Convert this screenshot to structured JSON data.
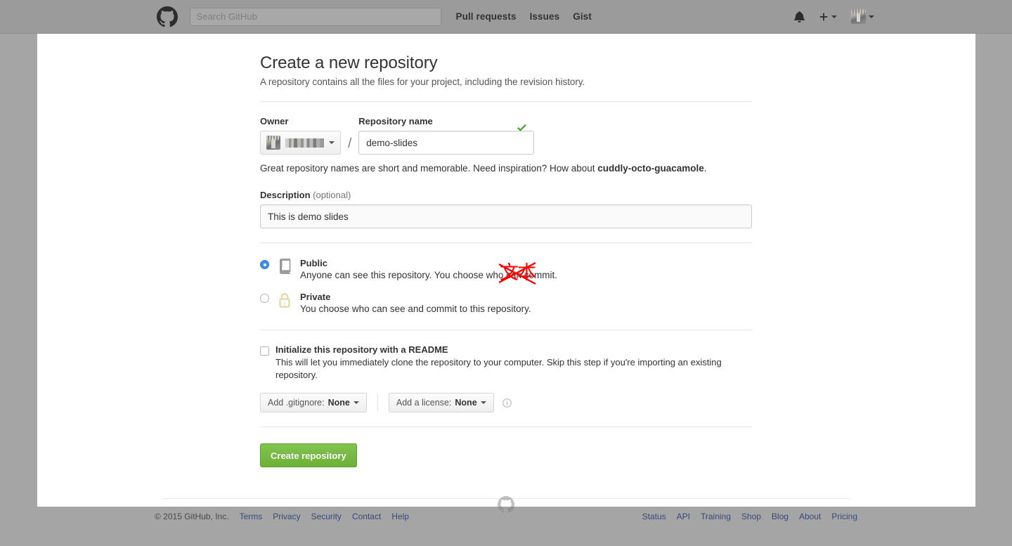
{
  "header": {
    "logo_icon": "github-mark-icon",
    "search": {
      "placeholder": "Search GitHub",
      "value": ""
    },
    "nav": [
      {
        "label": "Pull requests"
      },
      {
        "label": "Issues"
      },
      {
        "label": "Gist"
      }
    ],
    "notifications_icon": "bell-icon",
    "create_new_icon": "plus-icon",
    "create_new_caret": "chevron-down-icon",
    "avatar_caret": "chevron-down-icon"
  },
  "main": {
    "title": "Create a new repository",
    "subtitle": "A repository contains all the files for your project, including the revision history.",
    "owner": {
      "label": "Owner",
      "name_redacted": true,
      "caret_icon": "chevron-down-icon"
    },
    "separator": "/",
    "repository_name": {
      "label": "Repository name",
      "value": "demo-slides",
      "placeholder": "",
      "valid_icon": "check-icon"
    },
    "hint": {
      "prefix": "Great repository names are short and memorable. Need inspiration? How about ",
      "suggestion": "cuddly-octo-guacamole",
      "suffix": "."
    },
    "description": {
      "label": "Description",
      "optional_tag": "(optional)",
      "value": "This is demo slides",
      "placeholder": ""
    },
    "visibility": [
      {
        "id": "public",
        "title": "Public",
        "description": "Anyone can see this repository. You choose who can commit.",
        "icon": "repo-book-icon",
        "selected": true
      },
      {
        "id": "private",
        "title": "Private",
        "description": "You choose who can see and commit to this repository.",
        "icon": "lock-icon",
        "selected": false
      }
    ],
    "annotation_overlay": {
      "text": "文本",
      "color": "#ff0000",
      "strikethrough": true
    },
    "readme": {
      "title": "Initialize this repository with a README",
      "description": "This will let you immediately clone the repository to your computer. Skip this step if you're importing an existing repository.",
      "checked": false
    },
    "gitignore_select": {
      "prefix": "Add .gitignore: ",
      "value": "None",
      "caret_icon": "chevron-down-icon"
    },
    "license_select": {
      "prefix": "Add a license: ",
      "value": "None",
      "caret_icon": "chevron-down-icon"
    },
    "info_icon": "info-circle-icon",
    "submit_label": "Create repository"
  },
  "footer": {
    "copyright": "© 2015 GitHub, Inc.",
    "left_links": [
      {
        "label": "Terms"
      },
      {
        "label": "Privacy"
      },
      {
        "label": "Security"
      },
      {
        "label": "Contact"
      },
      {
        "label": "Help"
      }
    ],
    "right_links": [
      {
        "label": "Status"
      },
      {
        "label": "API"
      },
      {
        "label": "Training"
      },
      {
        "label": "Shop"
      },
      {
        "label": "Blog"
      },
      {
        "label": "About"
      },
      {
        "label": "Pricing"
      }
    ],
    "octocat_icon": "github-mark-icon"
  },
  "colors": {
    "page_background": "#a5a5a5",
    "header_background": "#9b9b9b",
    "card_background": "#ffffff",
    "accent_green": "#6cb136",
    "radio_blue": "#3e8fe0",
    "valid_green": "#4a9f35",
    "annotation_red": "#ff0000",
    "link_blue": "#3a4a78"
  }
}
